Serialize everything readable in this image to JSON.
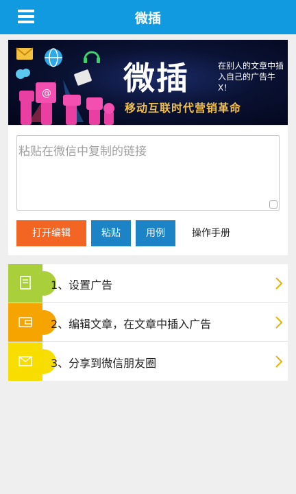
{
  "header": {
    "title": "微插",
    "menu_icon": "hamburger-menu-icon"
  },
  "banner": {
    "big_text": "微插",
    "small_text": "在别人的文章中插入自己的广告牛X！",
    "slogan": "移动互联时代营销革命"
  },
  "input": {
    "placeholder": "粘贴在微信中复制的链接",
    "value": ""
  },
  "buttons": {
    "open_edit": "打开编辑",
    "paste": "粘贴",
    "example": "用例",
    "manual": "操作手册"
  },
  "steps": [
    {
      "label": "1、设置广告",
      "icon": "document-icon",
      "color": "#a9cf3a"
    },
    {
      "label": "2、编辑文章，在文章中插入广告",
      "icon": "wallet-icon",
      "color": "#f5a400"
    },
    {
      "label": "3、分享到微信朋友圈",
      "icon": "envelope-icon",
      "color": "#f7de00"
    }
  ],
  "colors": {
    "header": "#129ae0",
    "open_button": "#f26522",
    "blue_button": "#1b83c6",
    "slogan": "#f2c14e"
  }
}
